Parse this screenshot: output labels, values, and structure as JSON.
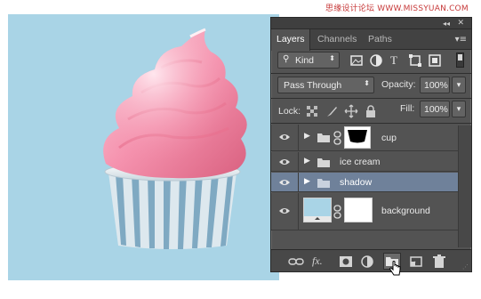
{
  "watermark": "思缘设计论坛 WWW.MISSYUAN.COM",
  "panel": {
    "tabs": [
      {
        "label": "Layers",
        "active": true
      },
      {
        "label": "Channels",
        "active": false
      },
      {
        "label": "Paths",
        "active": false
      }
    ],
    "filter": {
      "label": "Kind"
    },
    "blend_mode": "Pass Through",
    "opacity": {
      "label": "Opacity:",
      "value": "100%"
    },
    "lock": {
      "label": "Lock:"
    },
    "fill": {
      "label": "Fill:",
      "value": "100%"
    },
    "layers": [
      {
        "name": "cup",
        "type": "group",
        "visible": true,
        "selected": false,
        "has_mask": true
      },
      {
        "name": "ice cream",
        "type": "group",
        "visible": true,
        "selected": false
      },
      {
        "name": "shadow",
        "type": "group",
        "visible": true,
        "selected": true
      },
      {
        "name": "background",
        "type": "layer",
        "visible": true,
        "selected": false,
        "has_mask": true
      }
    ],
    "footer_icons": [
      "link-icon",
      "fx-icon",
      "mask-icon",
      "adjustment-icon",
      "new-group-icon",
      "new-layer-icon",
      "trash-icon"
    ]
  },
  "colors": {
    "canvas_bg": "#a9d4e6",
    "panel_bg": "#535353",
    "selected_row": "#6f819a"
  }
}
